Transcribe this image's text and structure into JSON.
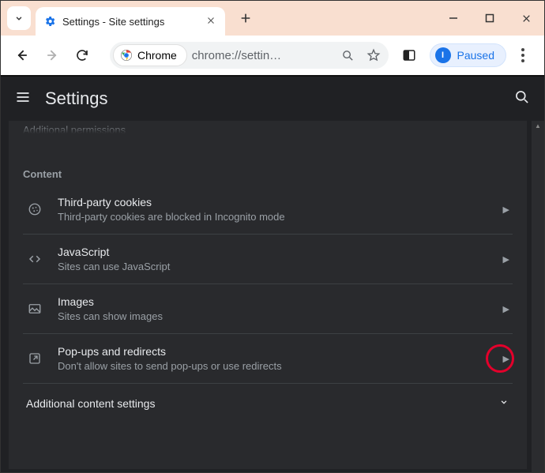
{
  "tab": {
    "title": "Settings - Site settings"
  },
  "toolbar": {
    "chrome_chip": "Chrome",
    "url": "chrome://settin…",
    "paused": "Paused",
    "avatar_letter": "I"
  },
  "settings": {
    "header_title": "Settings",
    "truncated_row": "Additional permissions",
    "section_label": "Content",
    "rows": [
      {
        "icon": "cookie-icon",
        "title": "Third-party cookies",
        "sub": "Third-party cookies are blocked in Incognito mode"
      },
      {
        "icon": "code-icon",
        "title": "JavaScript",
        "sub": "Sites can use JavaScript"
      },
      {
        "icon": "image-icon",
        "title": "Images",
        "sub": "Sites can show images"
      },
      {
        "icon": "popup-icon",
        "title": "Pop-ups and redirects",
        "sub": "Don't allow sites to send pop-ups or use redirects"
      }
    ],
    "expand_row": "Additional content settings"
  }
}
